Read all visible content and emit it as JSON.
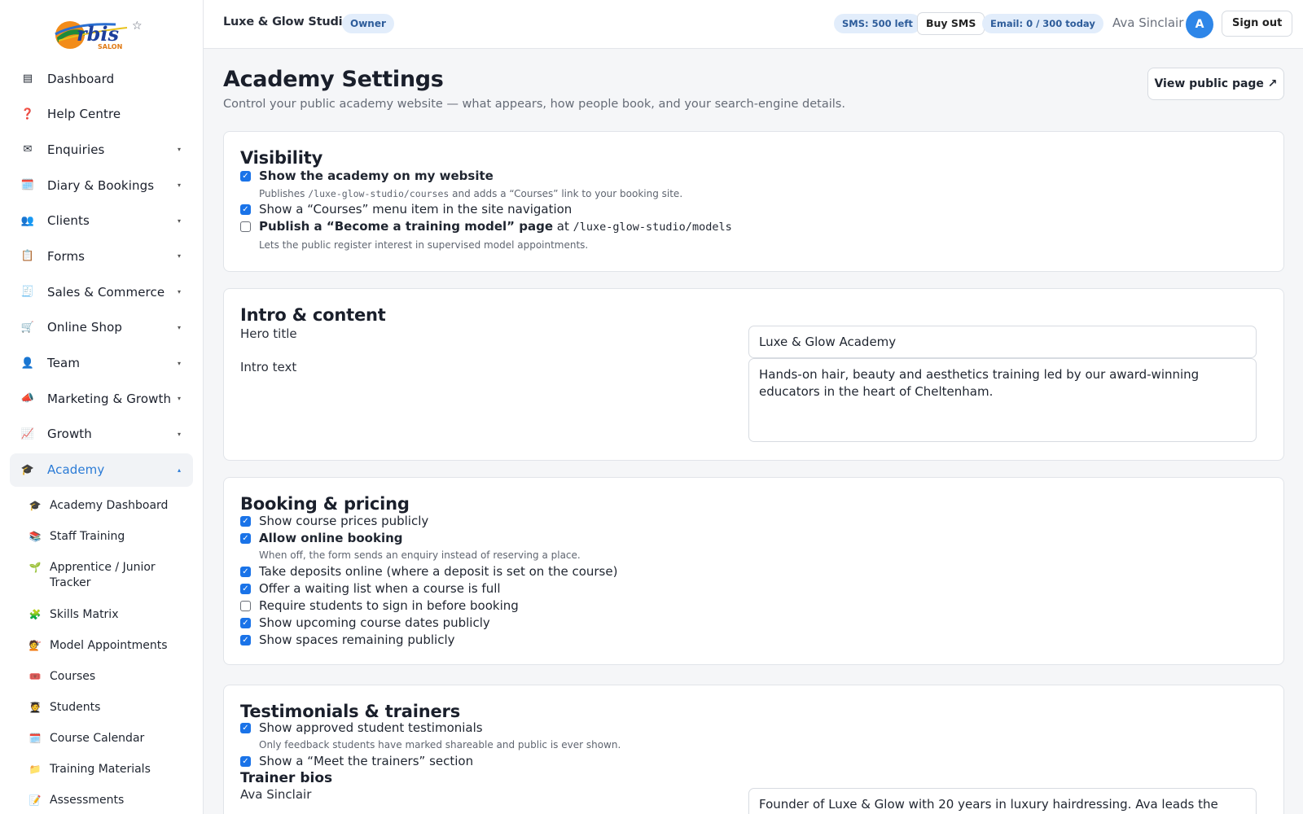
{
  "brand": {
    "logo_text": "Orbis",
    "logo_sub": "SALON"
  },
  "sidebar": {
    "items": [
      {
        "label": "Dashboard",
        "icon": "dashboard-icon",
        "glyph": "▤"
      },
      {
        "label": "Help Centre",
        "icon": "help-icon",
        "glyph": "❓"
      },
      {
        "label": "Enquiries",
        "icon": "envelope-icon",
        "glyph": "✉",
        "chevron": "▾"
      },
      {
        "label": "Diary & Bookings",
        "icon": "calendar-icon",
        "glyph": "🗓️",
        "chevron": "▾"
      },
      {
        "label": "Clients",
        "icon": "people-icon",
        "glyph": "👥",
        "chevron": "▾"
      },
      {
        "label": "Forms",
        "icon": "clipboard-icon",
        "glyph": "📋",
        "chevron": "▾"
      },
      {
        "label": "Sales & Commerce",
        "icon": "receipt-icon",
        "glyph": "🧾",
        "chevron": "▾"
      },
      {
        "label": "Online Shop",
        "icon": "cart-icon",
        "glyph": "🛒",
        "chevron": "▾"
      },
      {
        "label": "Team",
        "icon": "person-icon",
        "glyph": "👤",
        "chevron": "▾"
      },
      {
        "label": "Marketing & Growth",
        "icon": "megaphone-icon",
        "glyph": "📣",
        "chevron": "▾"
      },
      {
        "label": "Growth",
        "icon": "chart-up-icon",
        "glyph": "📈",
        "chevron": "▾"
      },
      {
        "label": "Academy",
        "icon": "graduation-cap-icon",
        "glyph": "🎓",
        "chevron": "▴"
      }
    ],
    "academy_sub": [
      {
        "label": "Academy Dashboard",
        "icon": "graduation-cap-icon",
        "glyph": "🎓"
      },
      {
        "label": "Staff Training",
        "icon": "books-icon",
        "glyph": "📚"
      },
      {
        "label": "Apprentice / Junior Tracker",
        "icon": "seedling-icon",
        "glyph": "🌱"
      },
      {
        "label": "Skills Matrix",
        "icon": "puzzle-icon",
        "glyph": "🧩"
      },
      {
        "label": "Model Appointments",
        "icon": "haircut-icon",
        "glyph": "💇"
      },
      {
        "label": "Courses",
        "icon": "ticket-icon",
        "glyph": "🎟️"
      },
      {
        "label": "Students",
        "icon": "student-icon",
        "glyph": "🧑‍🎓"
      },
      {
        "label": "Course Calendar",
        "icon": "calendar-icon",
        "glyph": "🗓️"
      },
      {
        "label": "Training Materials",
        "icon": "folder-icon",
        "glyph": "📁"
      },
      {
        "label": "Assessments",
        "icon": "memo-icon",
        "glyph": "📝"
      }
    ]
  },
  "header": {
    "studio_name": "Luxe & Glow Studio",
    "role": "Owner",
    "sms": "SMS: 500 left",
    "buy_sms": "Buy SMS",
    "email": "Email: 0 / 300 today",
    "user_name": "Ava Sinclair",
    "avatar_initial": "A",
    "sign_out": "Sign out"
  },
  "page": {
    "title": "Academy Settings",
    "subtitle": "Control your public academy website — what appears, how people book, and your search-engine details.",
    "view_public": "View public page ↗"
  },
  "visibility": {
    "heading": "Visibility",
    "show_academy": "Show the academy on my website",
    "hint1_pre": "Publishes ",
    "hint1_path": "/luxe-glow-studio/courses",
    "hint1_post": " and adds a “Courses” link to your booking site.",
    "show_menu": "Show a “Courses” menu item in the site navigation",
    "publish_model_bold": "Publish a “Become a training model” page",
    "publish_model_at": " at ",
    "publish_model_path": "/luxe-glow-studio/models",
    "hint2": "Lets the public register interest in supervised model appointments."
  },
  "intro": {
    "heading": "Intro & content",
    "hero_label": "Hero title",
    "hero_value": "Luxe & Glow Academy",
    "intro_label": "Intro text",
    "intro_value": "Hands-on hair, beauty and aesthetics training led by our award-winning educators in the heart of Cheltenham."
  },
  "booking": {
    "heading": "Booking & pricing",
    "show_prices": "Show course prices publicly",
    "allow_booking": "Allow online booking",
    "allow_hint": "When off, the form sends an enquiry instead of reserving a place.",
    "deposits": "Take deposits online (where a deposit is set on the course)",
    "waiting_list": "Offer a waiting list when a course is full",
    "require_signin": "Require students to sign in before booking",
    "upcoming_dates": "Show upcoming course dates publicly",
    "spaces": "Show spaces remaining publicly"
  },
  "testimonials": {
    "heading": "Testimonials & trainers",
    "show_testimonials": "Show approved student testimonials",
    "testimonials_hint": "Only feedback students have marked shareable and public is ever shown.",
    "meet_trainers": "Show a “Meet the trainers” section",
    "bios_heading": "Trainer bios",
    "trainer_name": "Ava Sinclair",
    "trainer_bio": "Founder of Luxe & Glow with 20 years in luxury hairdressing. Ava leads the creative"
  },
  "colors": {
    "accent": "#1a73e8",
    "avatar": "#2e86e8",
    "active_nav_text": "#2b7bd6",
    "badge_bg": "#e2edfb",
    "badge_text": "#2d5c9a"
  }
}
